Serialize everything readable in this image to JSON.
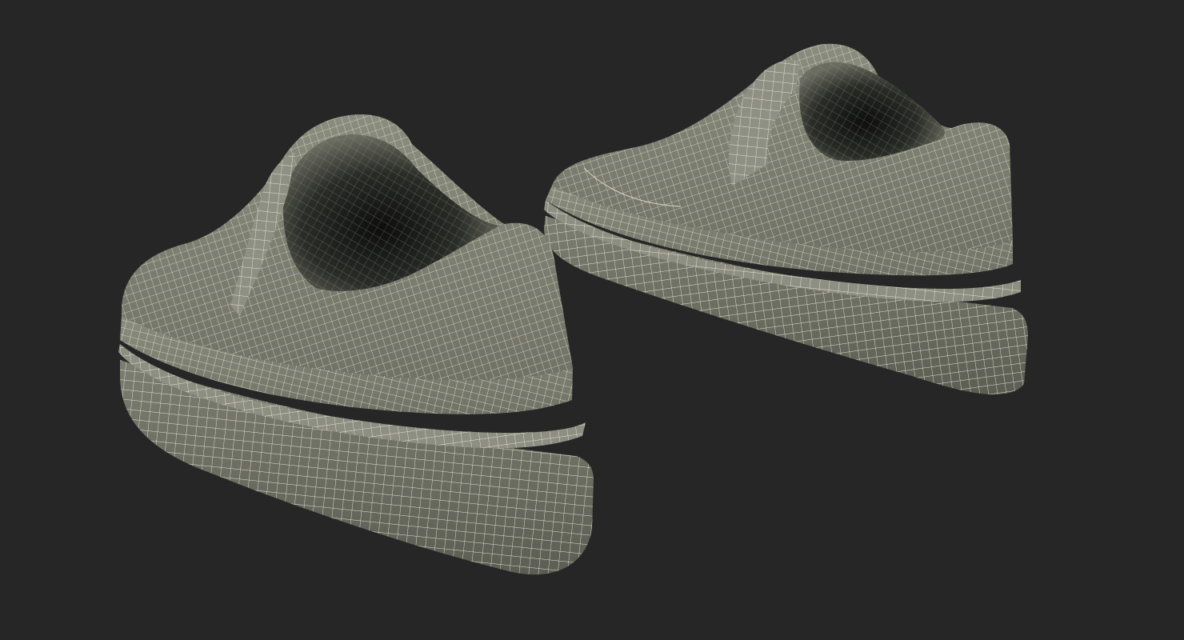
{
  "scene": {
    "background_color": "#262626",
    "surface_color": "#7d7f71",
    "surface_shadow_color": "#5d5f55",
    "inner_shadow_color": "#121312",
    "wire_color": "#f0efdc",
    "render_style": "wireframe-over-shaded"
  },
  "objects": [
    {
      "kind": "sneaker",
      "side": "left",
      "view": "rear-three-quarter"
    },
    {
      "kind": "sneaker",
      "side": "right",
      "view": "rear-three-quarter"
    }
  ]
}
